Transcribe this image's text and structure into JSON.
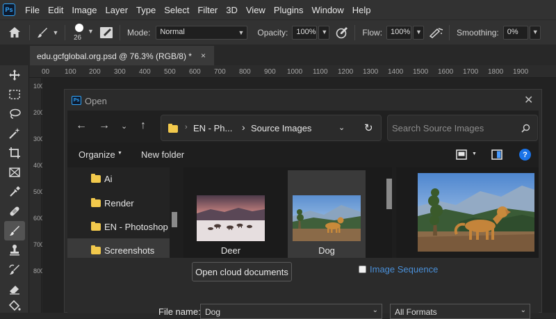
{
  "app": {
    "logo_text": "Ps",
    "menu": [
      "File",
      "Edit",
      "Image",
      "Layer",
      "Type",
      "Select",
      "Filter",
      "3D",
      "View",
      "Plugins",
      "Window",
      "Help"
    ]
  },
  "options": {
    "brush_size": "26",
    "mode_label": "Mode:",
    "mode_value": "Normal",
    "opacity_label": "Opacity:",
    "opacity_value": "100%",
    "flow_label": "Flow:",
    "flow_value": "100%",
    "smoothing_label": "Smoothing:",
    "smoothing_value": "0%"
  },
  "document": {
    "tab_title": "edu.gcfglobal.org.psd @ 76.3% (RGB/8) *",
    "close_glyph": "×"
  },
  "ruler": {
    "top_labels": [
      "00",
      "100",
      "200",
      "300",
      "400",
      "500",
      "600",
      "700",
      "800",
      "900",
      "1000",
      "1100",
      "1200",
      "1300",
      "1400",
      "1500",
      "1600",
      "1700",
      "1800",
      "1900"
    ],
    "left_labels": [
      "100",
      "200",
      "300",
      "400",
      "500",
      "600",
      "700",
      "800"
    ]
  },
  "dialog": {
    "title": "Open",
    "logo_text": "Ps",
    "close_glyph": "✕",
    "address": {
      "crumb_1": "EN - Ph...",
      "crumb_2": "Source Images"
    },
    "search_placeholder": "Search Source Images",
    "commands": {
      "organize": "Organize",
      "new_folder": "New folder",
      "help": "?"
    },
    "nav_items": [
      "Ai",
      "Render",
      "EN - Photoshop",
      "Screenshots"
    ],
    "files": [
      {
        "name": "Deer",
        "selected": false
      },
      {
        "name": "Dog",
        "selected": true
      }
    ],
    "open_cloud_label": "Open cloud documents",
    "image_sequence_label": "Image Sequence",
    "file_name_label": "File name:",
    "file_name_value": "Dog",
    "format_value": "All Formats"
  },
  "colors": {
    "accent": "#31a8ff",
    "link": "#4a90d9",
    "folder": "#f2c94c",
    "help_circle": "#1a73e8"
  }
}
